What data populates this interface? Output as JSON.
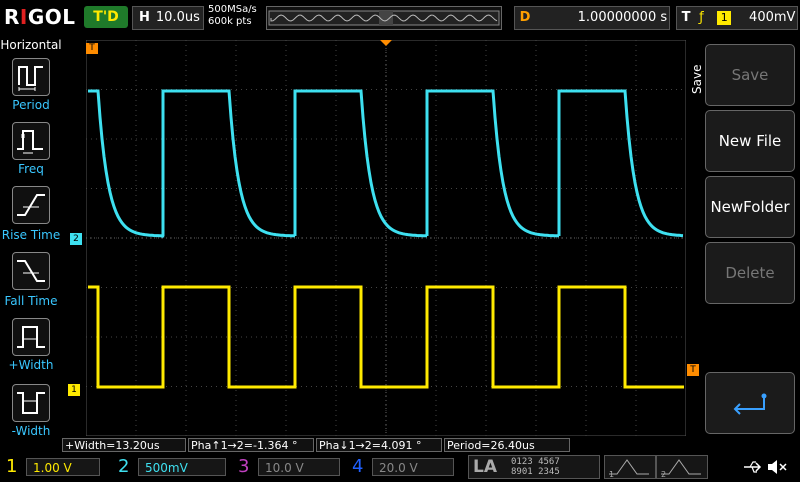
{
  "brand": "RIGOL",
  "run_state": "T'D",
  "horizontal": {
    "key": "H",
    "timebase": "10.0us"
  },
  "sample": {
    "rate": "500MSa/s",
    "points": "600k pts"
  },
  "delay": {
    "key": "D",
    "value": "1.00000000 s"
  },
  "trigger": {
    "key": "T",
    "source": "1",
    "level": "400mV"
  },
  "left_panel": {
    "title": "Horizontal",
    "items": [
      {
        "label": "Period"
      },
      {
        "label": "Freq"
      },
      {
        "label": "Rise Time"
      },
      {
        "label": "Fall Time"
      },
      {
        "label": "+Width"
      },
      {
        "label": "-Width"
      }
    ]
  },
  "right_menu": {
    "title": "Save",
    "buttons": [
      {
        "label": "Save",
        "enabled": false
      },
      {
        "label": "New File",
        "enabled": true
      },
      {
        "label": "NewFolder",
        "enabled": true
      },
      {
        "label": "Delete",
        "enabled": false
      }
    ]
  },
  "measurements": [
    "+Width=13.20us",
    "Pha↑1→2=-1.364 °",
    "Pha↓1→2=4.091 °",
    "Period=26.40us"
  ],
  "channels": [
    {
      "num": "1",
      "scale": "1.00 V",
      "color": "#ffea00"
    },
    {
      "num": "2",
      "scale": "500mV",
      "color": "#3ee0f0"
    },
    {
      "num": "3",
      "scale": "10.0 V",
      "color": "#c040c0"
    },
    {
      "num": "4",
      "scale": "20.0 V",
      "color": "#2060ff"
    }
  ],
  "la": {
    "label": "LA",
    "row1": "0123 4567",
    "row2": "8901 2345"
  },
  "markers": {
    "ch1": "1",
    "ch2": "2",
    "trig": "T"
  },
  "waveforms": {
    "ch2_color": "#3ee0f0",
    "ch1_color": "#ffea00",
    "period_us": 26.4,
    "plus_width_us": 13.2
  }
}
